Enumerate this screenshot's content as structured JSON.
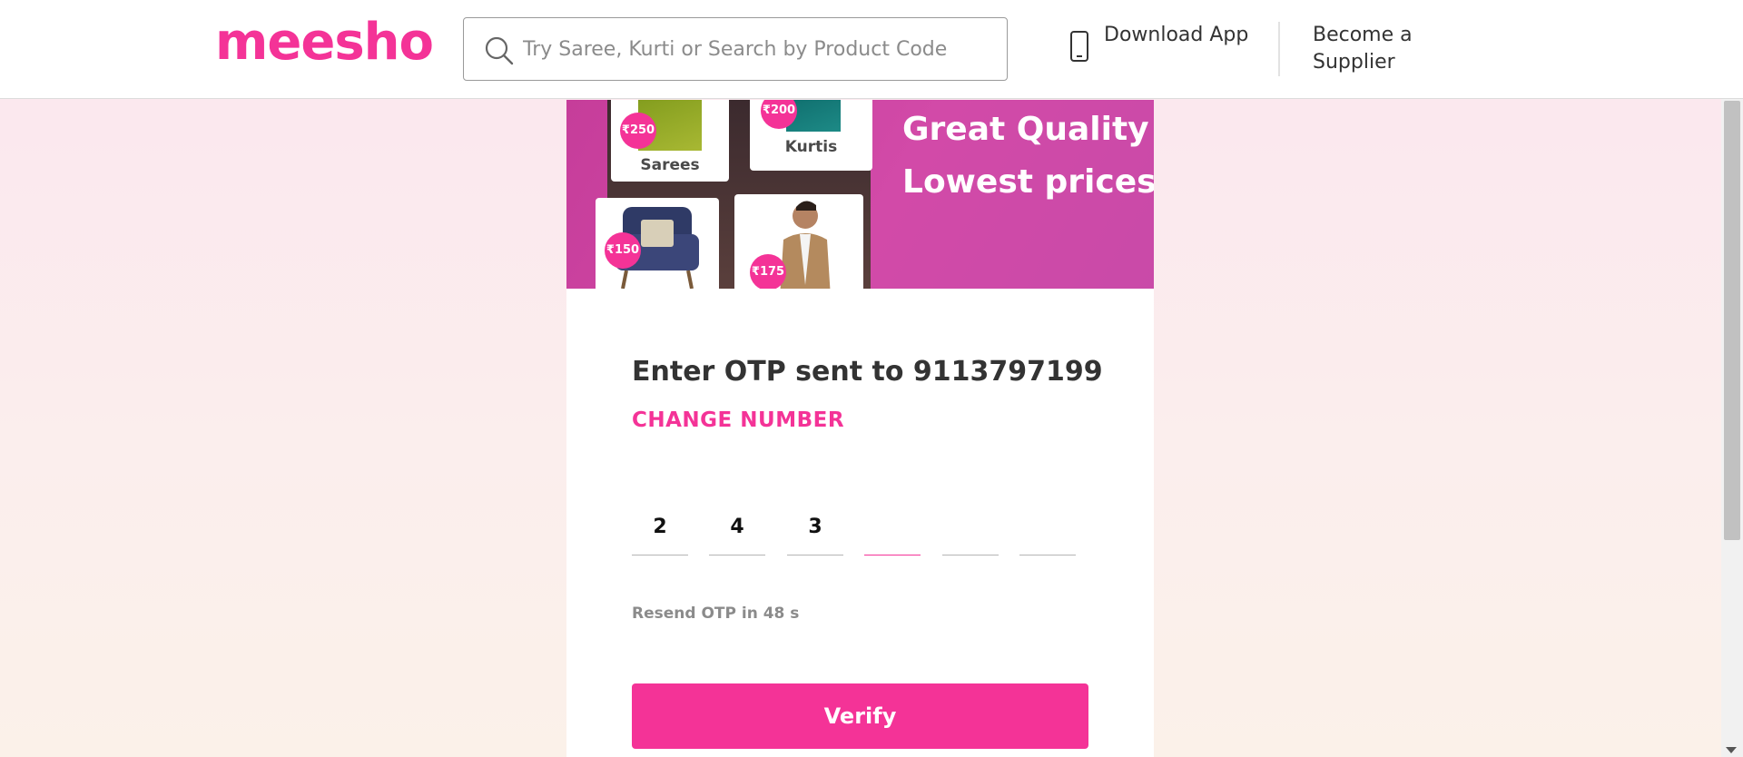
{
  "header": {
    "logo": "meesho",
    "search_placeholder": "Try Saree, Kurti or Search by Product Code",
    "download_label": "Download App",
    "supplier_label": "Become a Supplier"
  },
  "banner": {
    "title_line1": "Great Quality",
    "title_line2": "Lowest prices",
    "tiles": [
      {
        "label": "Sarees",
        "price": "₹250"
      },
      {
        "label": "Kurtis",
        "price": "₹200"
      },
      {
        "label": "",
        "price": "₹150"
      },
      {
        "label": "",
        "price": "₹175"
      }
    ]
  },
  "otp": {
    "title": "Enter OTP sent to 9113797199",
    "change_number": "CHANGE NUMBER",
    "digits": [
      "2",
      "4",
      "3",
      "",
      "",
      ""
    ],
    "resend": "Resend OTP in 48 s",
    "verify_label": "Verify"
  },
  "colors": {
    "brand": "#f43397"
  }
}
